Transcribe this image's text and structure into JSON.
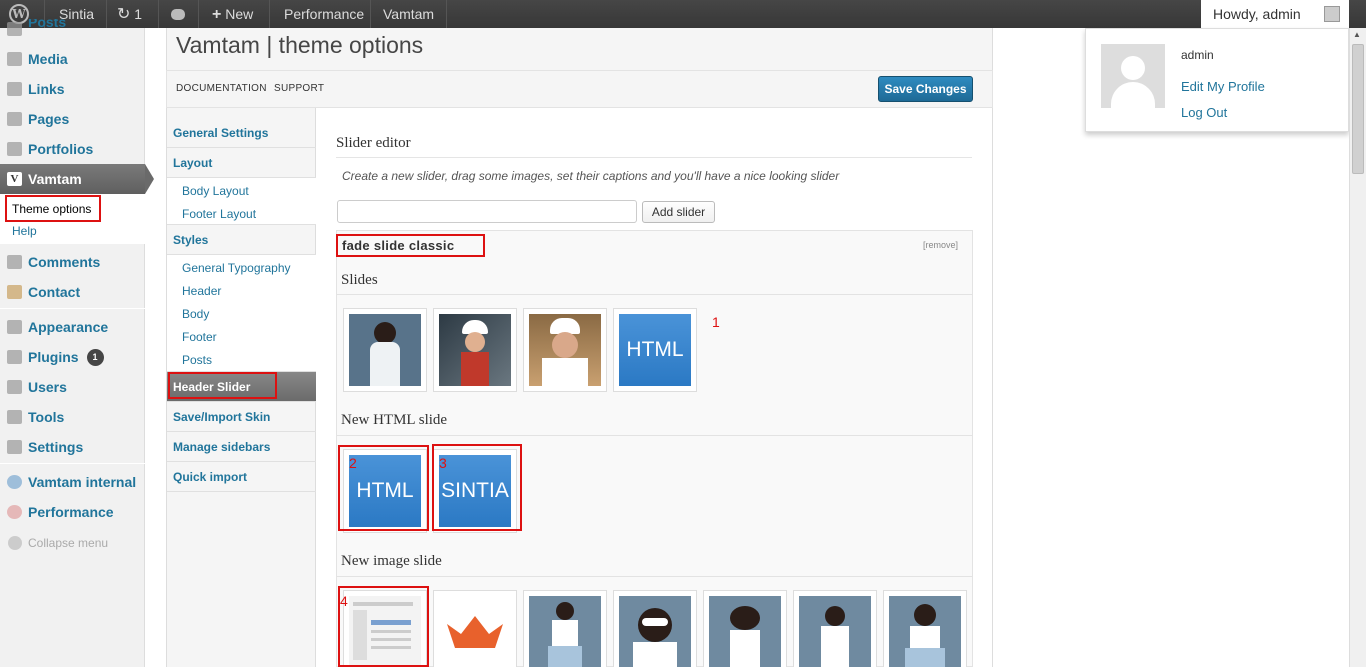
{
  "adminbar": {
    "site_name": "Sintia",
    "updates_count": "1",
    "new_label": "New",
    "performance_label": "Performance",
    "vamtam_label": "Vamtam",
    "howdy": "Howdy, admin"
  },
  "user_dropdown": {
    "username": "admin",
    "edit_profile": "Edit My Profile",
    "logout": "Log Out"
  },
  "admin_menu": {
    "posts": "Posts",
    "media": "Media",
    "links": "Links",
    "pages": "Pages",
    "portfolios": "Portfolios",
    "vamtam": "Vamtam",
    "theme_options": "Theme options",
    "help": "Help",
    "comments": "Comments",
    "contact": "Contact",
    "appearance": "Appearance",
    "plugins": "Plugins",
    "plugins_badge": "1",
    "users": "Users",
    "tools": "Tools",
    "settings": "Settings",
    "vamtam_internal": "Vamtam internal",
    "performance": "Performance",
    "collapse": "Collapse menu"
  },
  "options": {
    "title": "Vamtam | theme options",
    "documentation": "DOCUMENTATION",
    "support": "SUPPORT",
    "save": "Save Changes"
  },
  "tabs": {
    "general": "General Settings",
    "layout": "Layout",
    "body_layout": "Body Layout",
    "footer_layout": "Footer Layout",
    "styles": "Styles",
    "general_typography": "General Typography",
    "header": "Header",
    "body": "Body",
    "footer": "Footer",
    "posts": "Posts",
    "header_slider": "Header Slider",
    "save_import": "Save/Import Skin",
    "manage_sidebars": "Manage sidebars",
    "quick_import": "Quick import"
  },
  "slider_editor": {
    "title": "Slider editor",
    "description": "Create a new slider, drag some images, set their captions and you'll have a nice looking slider",
    "input_value": "",
    "add_button": "Add slider",
    "slider_name": "fade slide classic",
    "remove": "[remove]",
    "slides_heading": "Slides",
    "new_html_heading": "New HTML slide",
    "new_image_heading": "New image slide",
    "slide_html_text": "HTML",
    "html_slide_1": "HTML",
    "html_slide_2": "SINTIA",
    "annotation_1": "1",
    "annotation_2": "2",
    "annotation_3": "3",
    "annotation_4": "4"
  }
}
